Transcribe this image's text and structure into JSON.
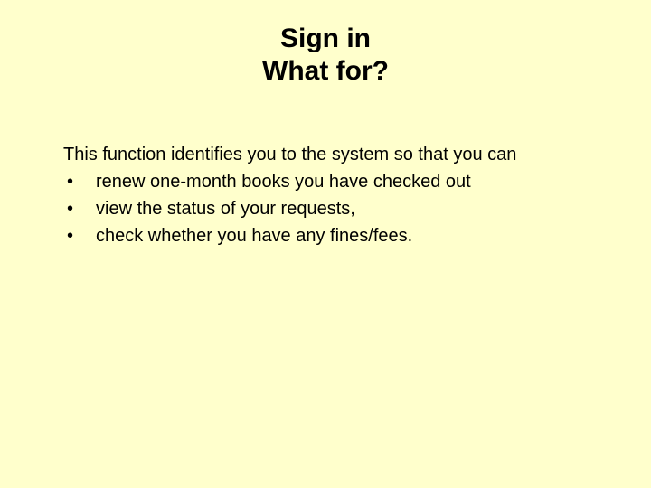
{
  "title": {
    "line1": "Sign in",
    "line2": "What for?"
  },
  "intro": "This function identifies you to the system so that you can",
  "bullets": [
    "renew one-month books you have checked out",
    "view the status of your requests,",
    "check whether you have any fines/fees."
  ],
  "bullet_char": "•"
}
